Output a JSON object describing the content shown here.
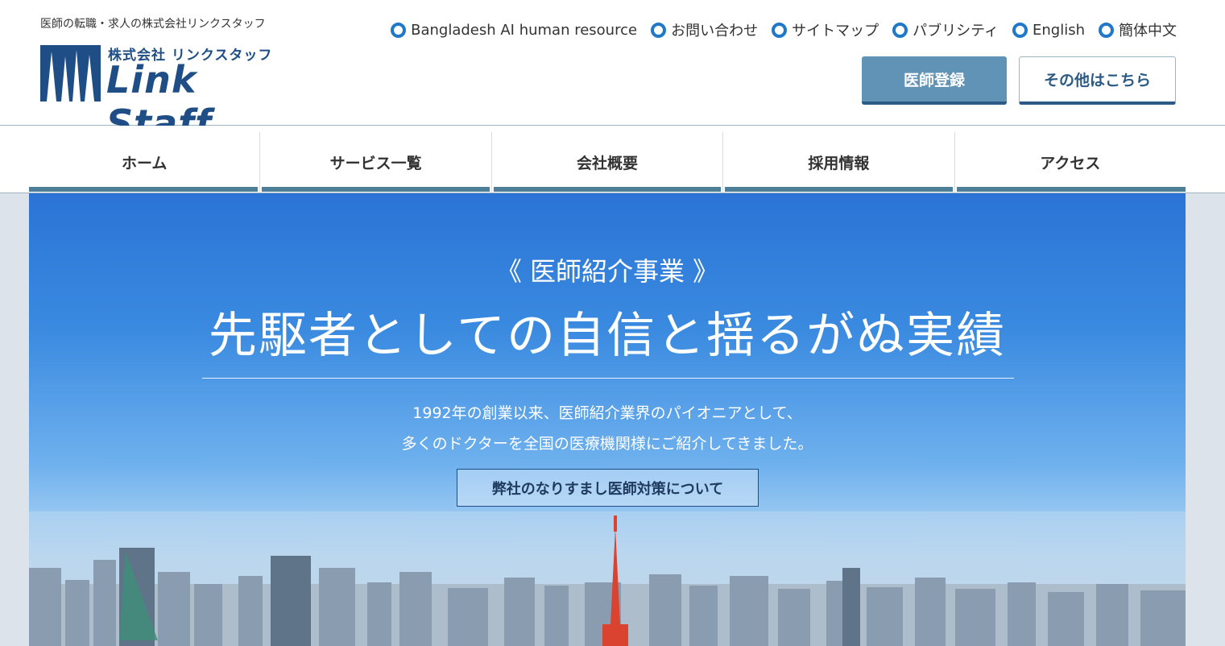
{
  "header": {
    "tagline": "医師の転職・求人の株式会社リンクスタッフ",
    "logo_sub": "株式会社 リンクスタッフ",
    "logo_main": "Link Staff",
    "top_links": [
      {
        "label": "Bangladesh AI human resource",
        "icon": "ring-bullet-icon"
      },
      {
        "label": "お問い合わせ",
        "icon": "ring-bullet-icon"
      },
      {
        "label": "サイトマップ",
        "icon": "ring-bullet-icon"
      },
      {
        "label": "パブリシティ",
        "icon": "ring-bullet-icon"
      },
      {
        "label": "English",
        "icon": "ring-bullet-icon"
      },
      {
        "label": "簡体中文",
        "icon": "ring-bullet-icon"
      }
    ],
    "register_button": "医師登録",
    "other_button": "その他はこちら"
  },
  "nav": {
    "items": [
      {
        "label": "ホーム"
      },
      {
        "label": "サービス一覧"
      },
      {
        "label": "会社概要"
      },
      {
        "label": "採用情報"
      },
      {
        "label": "アクセス"
      }
    ]
  },
  "hero": {
    "eyebrow": "《 医師紹介事業 》",
    "title": "先駆者としての自信と揺るがぬ実績",
    "text_line1": "1992年の創業以来、医師紹介業界のパイオニアとして、",
    "text_line2": "多くのドクターを全国の医療機関様にご紹介してきました。",
    "button": "弊社のなりすまし医師対策について"
  },
  "colors": {
    "brand": "#1f4e86",
    "bullet": "#1f78c8",
    "nav_bar": "#4f7f98",
    "register_button": "#6193b7"
  }
}
